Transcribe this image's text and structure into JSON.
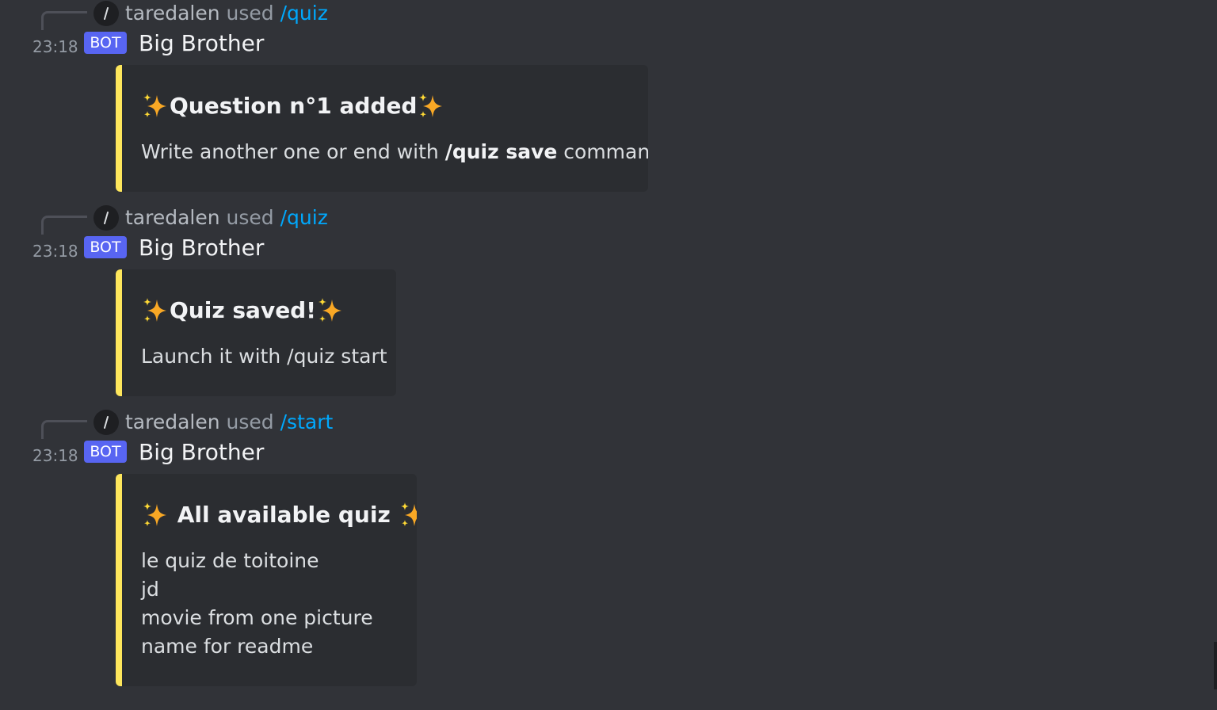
{
  "colors": {
    "background": "#313338",
    "embed_bg": "#2b2d31",
    "embed_accent": "#fee75c",
    "bot_badge": "#5865f2",
    "command_link": "#00a8fc"
  },
  "messages": [
    {
      "command_user": "taredalen",
      "command_used": "used",
      "command_name": "/quiz",
      "timestamp": "23:18",
      "badge": "BOT",
      "author": "Big Brother",
      "embed": {
        "title_icon_left": "sparkles-icon",
        "title": "Question n°1 added",
        "title_icon_right": "sparkles-icon",
        "desc_before": "Write another one or end with ",
        "desc_bold": "/quiz save",
        "desc_after": " command."
      }
    },
    {
      "command_user": "taredalen",
      "command_used": "used",
      "command_name": "/quiz",
      "timestamp": "23:18",
      "badge": "BOT",
      "author": "Big Brother",
      "embed": {
        "title_icon_left": "sparkles-icon",
        "title": "Quiz saved!",
        "title_icon_right": "sparkles-icon",
        "desc": "Launch it with /quiz start"
      }
    },
    {
      "command_user": "taredalen",
      "command_used": "used",
      "command_name": "/start",
      "timestamp": "23:18",
      "badge": "BOT",
      "author": "Big Brother",
      "embed": {
        "title_icon_left": "sparkles-icon",
        "title": " All available quiz ",
        "title_icon_right": "sparkles-icon",
        "quiz_list": [
          "le quiz de toitoine",
          "jd",
          "movie from one picture",
          "name for readme"
        ]
      }
    }
  ]
}
